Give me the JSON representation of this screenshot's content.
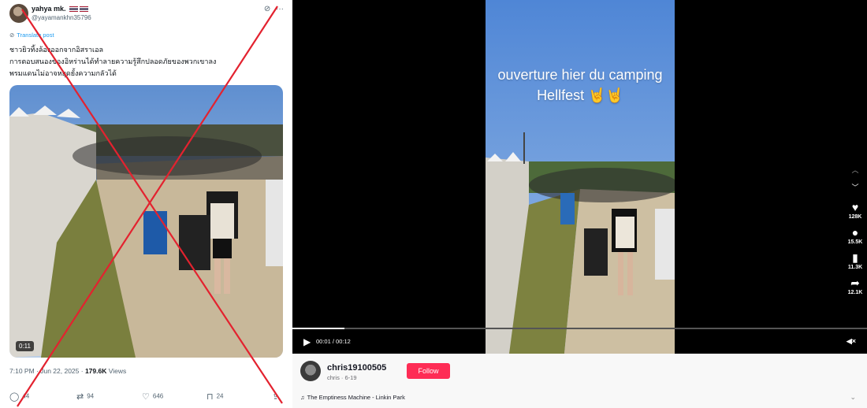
{
  "tweet": {
    "display_name": "yahya mk.",
    "handle": "@yayamankhn35796",
    "translate_label": "Translate post",
    "text_lines": [
      "ชาวยิวทิ้งล้องออกจากอิสราเอล",
      "การตอบสนองของอิหร่านได้ทำลายความรู้สึกปลอดภัยของพวกเขาลง",
      "พรมแดนไม่อาจหยุดยั้งความกลัวได้"
    ],
    "video_duration": "0:11",
    "time": "7:10 PM",
    "date": "Jun 22, 2025",
    "views_count": "179.6K",
    "views_label": "Views",
    "actions": {
      "replies": "44",
      "reposts": "94",
      "likes": "646",
      "bookmarks": "24"
    },
    "icons": [
      "grok-icon",
      "more-icon",
      "globe-icon",
      "reply-icon",
      "repost-icon",
      "like-icon",
      "bookmark-icon",
      "share-icon"
    ]
  },
  "tiktok": {
    "caption_line1": "ouverture hier du camping",
    "caption_line2": "Hellfest 🤘🤘",
    "progress": 0.09,
    "time_display": "00:01 / 00:12",
    "side": {
      "likes": "128K",
      "comments": "15.5K",
      "saves": "11.3K",
      "shares": "12.1K"
    },
    "username": "chris19100505",
    "subline": "chris · 6-19",
    "follow_label": "Follow",
    "music": "The Emptiness Machine - Linkin Park",
    "icons": [
      "chevron-up-icon",
      "chevron-down-icon",
      "heart-icon",
      "comment-icon",
      "bookmark-icon",
      "share-icon",
      "play-icon",
      "mute-icon",
      "music-note-icon"
    ]
  },
  "colors": {
    "cross": "#e3222f",
    "follow": "#fe2c55",
    "link": "#1d9bf0"
  }
}
